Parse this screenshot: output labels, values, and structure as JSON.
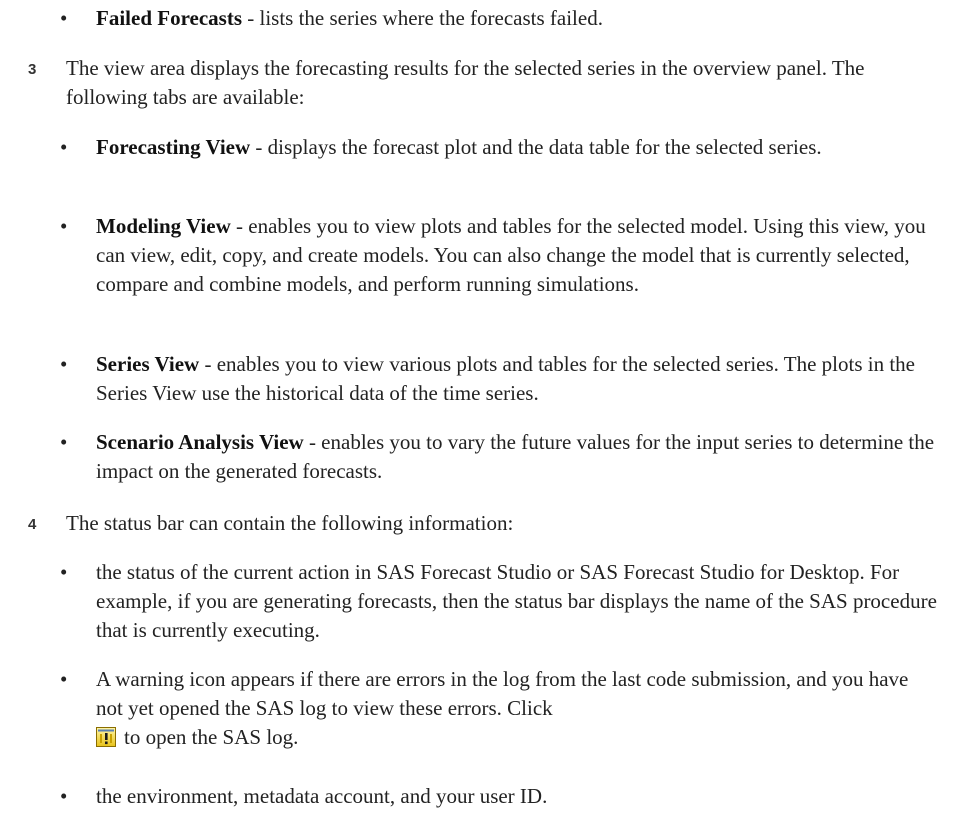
{
  "bullet_char": "•",
  "intro_bullet": {
    "term": "Failed Forecasts",
    "text": " - lists the series where the forecasts failed."
  },
  "step3": {
    "number": "3",
    "text": "The view area displays the forecasting results for the selected series in the overview panel. The following tabs are available:",
    "items": [
      {
        "term": "Forecasting View",
        "text": " - displays the forecast plot and the data table for the selected series."
      },
      {
        "term": "Modeling View",
        "text": " - enables you to view plots and tables for the selected model. Using this view, you can view, edit, copy, and create models. You can also change the model that is currently selected, compare and combine models, and perform running simulations."
      },
      {
        "term": "Series View",
        "text": " - enables you to view various plots and tables for the selected series. The plots in the Series View use the historical data of the time series."
      },
      {
        "term": "Scenario Analysis View",
        "text": " - enables you to vary the future values for the input series to determine the impact on the generated forecasts."
      }
    ]
  },
  "step4": {
    "number": "4",
    "text": "The status bar can contain the following information:",
    "items": [
      {
        "text": "the status of the current action in SAS Forecast Studio or SAS Forecast Studio for Desktop. For example, if you are generating forecasts, then the status bar displays the name of the SAS procedure that is currently executing."
      },
      {
        "text": "A warning icon appears if there are errors in the log from the last code submission, and you have not yet opened the SAS log to view these errors. Click",
        "icon": "warning-log-icon",
        "after_icon": "to open the SAS log."
      },
      {
        "text": "the environment, metadata account, and your user ID."
      }
    ]
  }
}
